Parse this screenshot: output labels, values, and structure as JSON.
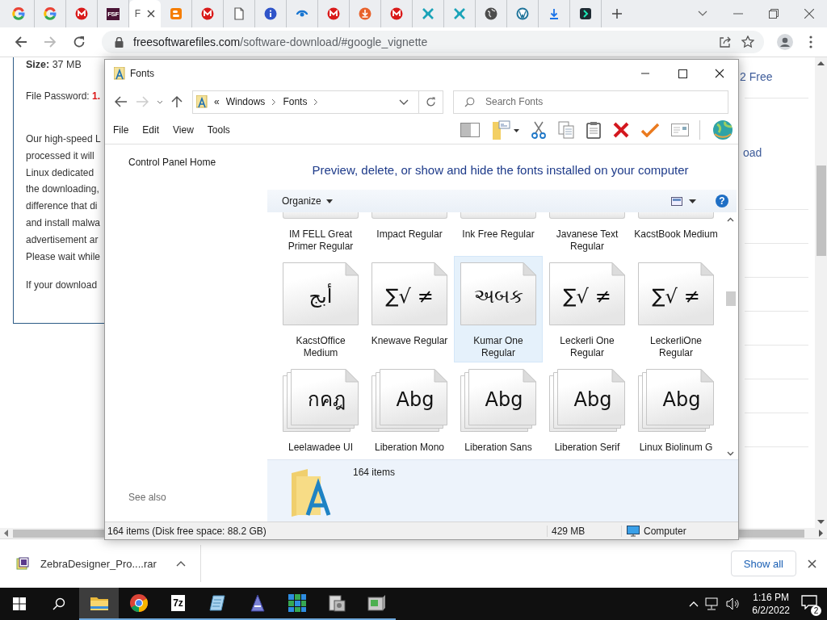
{
  "browser": {
    "tabs": [
      {
        "kind": "google",
        "selected": false
      },
      {
        "kind": "google",
        "selected": false
      },
      {
        "kind": "mail",
        "selected": false
      },
      {
        "kind": "fsf",
        "label": "FSF",
        "selected": false
      },
      {
        "kind": "page",
        "label": "F",
        "selected": true
      },
      {
        "kind": "blogger",
        "selected": false
      },
      {
        "kind": "mail",
        "selected": false
      },
      {
        "kind": "document",
        "selected": false
      },
      {
        "kind": "info",
        "selected": false
      },
      {
        "kind": "swirl",
        "selected": false
      },
      {
        "kind": "mail",
        "selected": false
      },
      {
        "kind": "download-circle",
        "selected": false
      },
      {
        "kind": "mail",
        "selected": false
      },
      {
        "kind": "cross",
        "selected": false
      },
      {
        "kind": "cross",
        "selected": false
      },
      {
        "kind": "globe",
        "selected": false
      },
      {
        "kind": "wordpress",
        "selected": false
      },
      {
        "kind": "download",
        "selected": false
      },
      {
        "kind": "play",
        "selected": false
      }
    ],
    "url_host": "freesoftwarefiles.com",
    "url_path": "/software-download/#google_vignette"
  },
  "page": {
    "size_text": "**Size:** 37 MB",
    "password_label": "File Password:",
    "password_value": "1.",
    "paragraph_lines": [
      "Our high-speed L",
      "processed it will",
      "Linux dedicated",
      "the downloading,",
      "difference that di",
      "and install malwa",
      "advertisement ar",
      "Please wait while"
    ],
    "last_line": "If your download",
    "side_links": [
      "2 Free",
      "oad"
    ]
  },
  "explorer": {
    "title": "Fonts",
    "overflow": "«",
    "breadcrumb": [
      "Windows",
      "Fonts"
    ],
    "search_placeholder": "Search Fonts",
    "menu": [
      "File",
      "Edit",
      "View",
      "Tools"
    ],
    "sidebar_link": "Control Panel Home",
    "see_also": "See also",
    "heading": "Preview, delete, or show and hide the fonts installed on your computer",
    "organize": "Organize",
    "help": "?",
    "fonts": [
      {
        "name": "IM FELL Great Primer Regular",
        "selected": false
      },
      {
        "name": "Impact Regular",
        "selected": false
      },
      {
        "name": "Ink Free Regular",
        "selected": false
      },
      {
        "name": "Javanese Text Regular",
        "selected": false
      },
      {
        "name": "KacstBook Medium",
        "selected": false
      },
      {
        "name": "KacstOffice Medium",
        "sample": "أبج",
        "stacked": false,
        "selected": false
      },
      {
        "name": "Knewave Regular",
        "sample": "∑√ ≠",
        "stacked": false,
        "selected": false
      },
      {
        "name": "Kumar One Regular",
        "sample": "અબક",
        "stacked": false,
        "selected": true
      },
      {
        "name": "Leckerli One Regular",
        "sample": "∑√ ≠",
        "stacked": false,
        "selected": false
      },
      {
        "name": "LeckerliOne Regular",
        "sample": "∑√ ≠",
        "stacked": false,
        "selected": false
      },
      {
        "name": "Leelawadee UI",
        "sample": "กคฎ",
        "stacked": true,
        "selected": false
      },
      {
        "name": "Liberation Mono",
        "sample": "Abg",
        "stacked": true,
        "selected": false
      },
      {
        "name": "Liberation Sans",
        "sample": "Abg",
        "stacked": true,
        "selected": false
      },
      {
        "name": "Liberation Serif",
        "sample": "Abg",
        "stacked": true,
        "selected": false
      },
      {
        "name": "Linux Biolinum G",
        "sample": "Abg",
        "stacked": true,
        "selected": false
      }
    ],
    "details_count": "164 items",
    "status": {
      "items": "164 items (Disk free space: 88.2 GB)",
      "size": "429 MB",
      "location": "Computer"
    }
  },
  "downloads": {
    "file": "ZebraDesigner_Pro....rar",
    "show_all": "Show all"
  },
  "taskbar": {
    "apps": [
      {
        "kind": "explorer",
        "selected": true
      },
      {
        "kind": "chrome",
        "selected": false
      },
      {
        "kind": "sevenzip",
        "label": "7z",
        "selected": false
      },
      {
        "kind": "notepad",
        "selected": false
      },
      {
        "kind": "font",
        "selected": false
      },
      {
        "kind": "tiles",
        "selected": false
      },
      {
        "kind": "installer",
        "selected": false
      },
      {
        "kind": "server",
        "selected": false
      }
    ],
    "time": "1:16 PM",
    "date": "6/2/2022",
    "notifications": "2"
  }
}
